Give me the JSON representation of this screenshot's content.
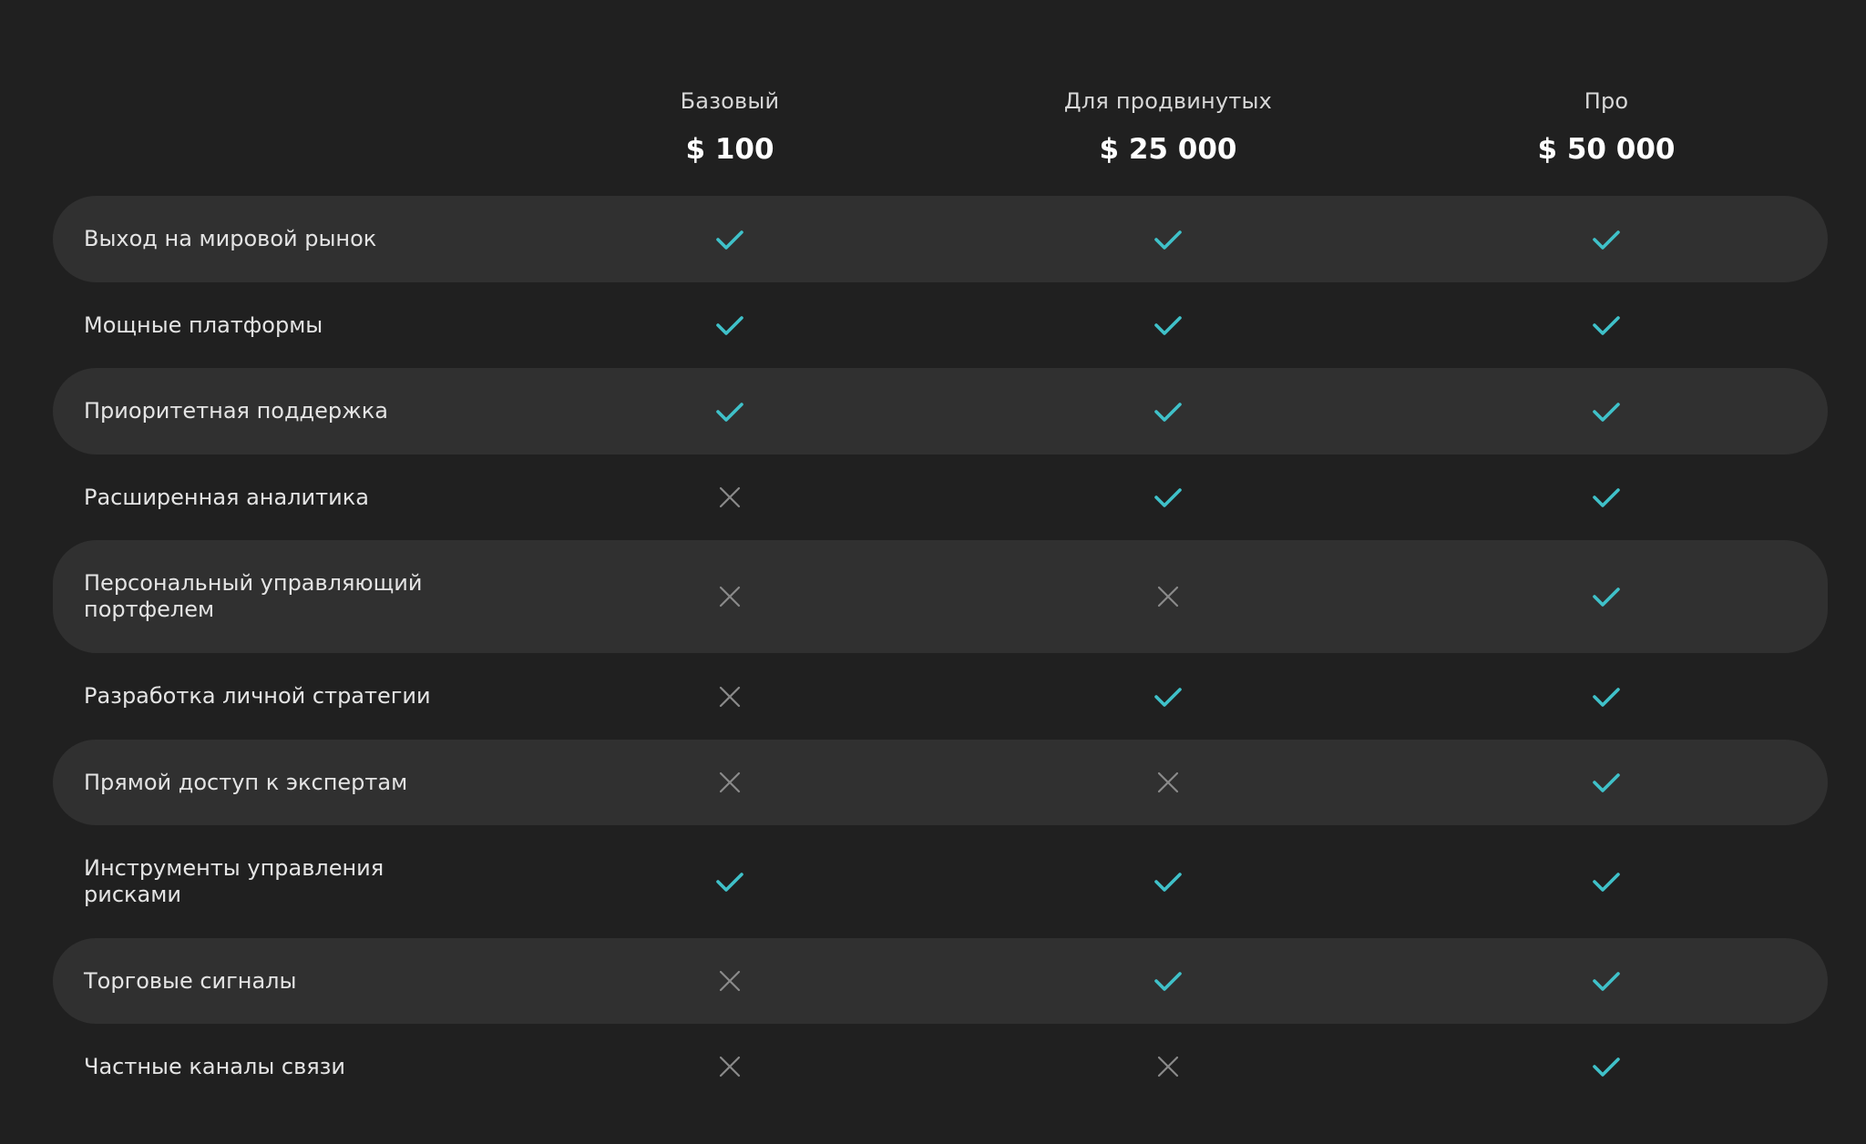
{
  "plans": [
    {
      "name": "Базовый",
      "price": "$ 100"
    },
    {
      "name": "Для продвинутых",
      "price": "$ 25 000"
    },
    {
      "name": "Про",
      "price": "$ 50 000"
    }
  ],
  "colors": {
    "background": "#202020",
    "shaded_row": "#303030",
    "check": "#3fc1c9",
    "cross": "#8a8a8a"
  },
  "icons": {
    "included": "check-icon",
    "excluded": "cross-icon"
  },
  "features": [
    {
      "label": "Выход на мировой рынок",
      "included": [
        true,
        true,
        true
      ]
    },
    {
      "label": "Мощные платформы",
      "included": [
        true,
        true,
        true
      ]
    },
    {
      "label": "Приоритетная поддержка",
      "included": [
        true,
        true,
        true
      ]
    },
    {
      "label": "Расширенная аналитика",
      "included": [
        false,
        true,
        true
      ]
    },
    {
      "label": "Персональный управляющий\nпортфелем",
      "included": [
        false,
        false,
        true
      ]
    },
    {
      "label": "Разработка личной стратегии",
      "included": [
        false,
        true,
        true
      ]
    },
    {
      "label": "Прямой доступ к экспертам",
      "included": [
        false,
        false,
        true
      ]
    },
    {
      "label": "Инструменты управления\nрисками",
      "included": [
        true,
        true,
        true
      ]
    },
    {
      "label": "Торговые сигналы",
      "included": [
        false,
        true,
        true
      ]
    },
    {
      "label": "Частные каналы связи",
      "included": [
        false,
        false,
        true
      ]
    }
  ]
}
